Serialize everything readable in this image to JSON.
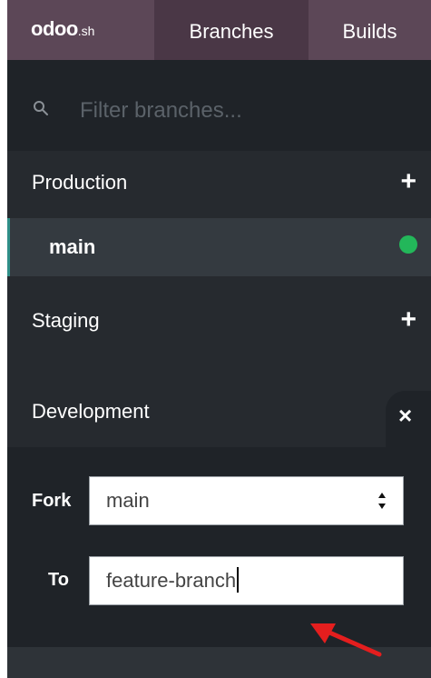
{
  "header": {
    "logo_main": "odoo",
    "logo_suffix": ".sh",
    "tabs": [
      {
        "label": "Branches",
        "active": true
      },
      {
        "label": "Builds",
        "active": false
      }
    ]
  },
  "filter": {
    "placeholder": "Filter branches...",
    "icon": "search-icon"
  },
  "sections": {
    "production": {
      "label": "Production",
      "add_icon": "+"
    },
    "production_branches": [
      {
        "name": "main",
        "status": "running",
        "status_color": "#23b75a"
      }
    ],
    "staging": {
      "label": "Staging",
      "add_icon": "+"
    },
    "development": {
      "label": "Development",
      "close_icon": "×",
      "fork": {
        "label": "Fork",
        "value": "main"
      },
      "to": {
        "label": "To",
        "value": "feature-branch"
      }
    }
  },
  "colors": {
    "header_bg": "#5c4757",
    "active_tab_bg": "#4a3746",
    "panel_bg": "#262a2f",
    "selected_row_bg": "#343a40",
    "accent_border": "#2f8f88",
    "annotation_arrow": "#e41e1e"
  }
}
